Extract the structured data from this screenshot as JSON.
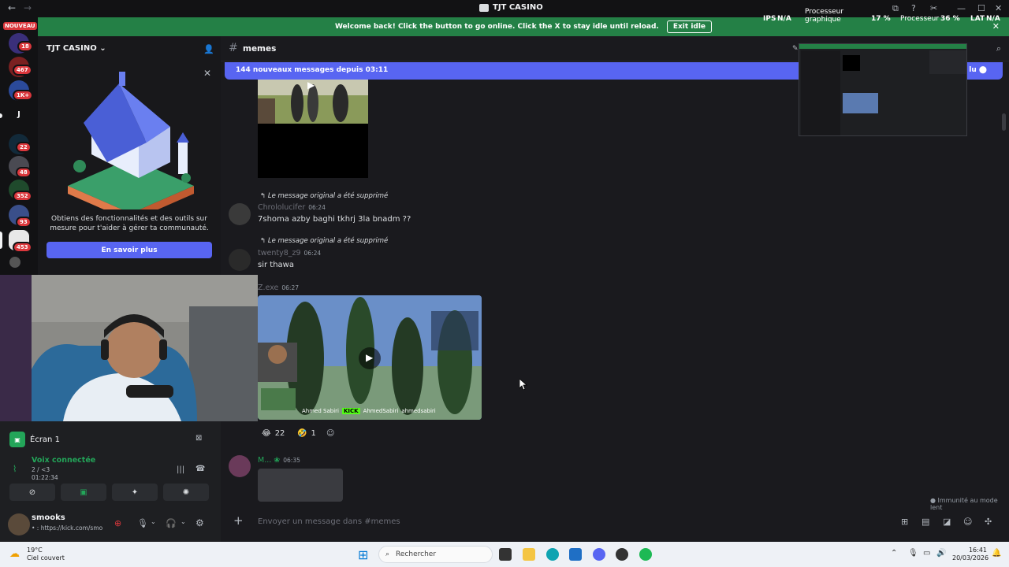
{
  "window": {
    "title": "TJT CASINO",
    "back": "←",
    "forward": "→",
    "minimize": "—",
    "maximize": "☐",
    "close": "✕"
  },
  "stats": {
    "ips_label": "IPS",
    "ips_value": "N/A",
    "gpu_label_1": "Processeur",
    "gpu_label_2": "graphique",
    "gpu_value": "17 %",
    "cpu_label": "Processeur",
    "cpu_value": "36 %",
    "lat_label": "LAT",
    "lat_value": "N/A"
  },
  "banner": {
    "text": "Welcome back! Click the button to go online. Click the X to stay idle until reload.",
    "button": "Exit idle",
    "close": "✕"
  },
  "rail": {
    "nouveau": "NOUVEAU",
    "badges": [
      "18",
      "18",
      "467",
      "1K+",
      "22",
      "48",
      "352",
      "93",
      "453"
    ],
    "letter_server": "J"
  },
  "sidebar": {
    "guild_name": "TJT CASINO",
    "promo_text": "Obtiens des fonctionnalités et des outils sur mesure pour t'aider à gérer ta communauté.",
    "promo_button": "En savoir plus",
    "close": "✕"
  },
  "voice": {
    "screen_label": "Écran 1",
    "status": "Voix connectée",
    "sub_1": "2 / <3",
    "sub_2": "01:22:34",
    "user_name": "smooks",
    "user_status": "• : https://kick.com/smo"
  },
  "chat": {
    "channel": "memes",
    "new_messages": "144 nouveaux messages depuis 03:11",
    "mark_read": "lu",
    "messages": [
      {
        "reply": "Le message original a été supprimé",
        "author": "Chrololucifer",
        "time": "06:24",
        "text": "7shoma azby baghi tkhrj 3la bnadm ??"
      },
      {
        "reply": "Le message original a été supprimé",
        "author": "twenty8_z9",
        "time": "06:24",
        "text": "sir   thawa"
      },
      {
        "author": "Z.exe",
        "time": "06:27",
        "overlay_1": "Ahmed Sabiri",
        "overlay_2": "KICK",
        "overlay_3": "AhmedSabiri",
        "overlay_4": "ahmedsabiri"
      },
      {
        "author": "M...",
        "time": "06:35"
      }
    ],
    "reactions": [
      {
        "emoji": "😂",
        "count": "22"
      },
      {
        "emoji": "🤣",
        "count": "1"
      }
    ],
    "composer_placeholder": "Envoyer un message dans #memes",
    "immunity": "Immunité au mode lent"
  },
  "taskbar": {
    "temp": "19°C",
    "weather": "Ciel couvert",
    "search": "Rechercher",
    "time": "16:41",
    "date": "20/03/2026"
  },
  "colors": {
    "accent": "#5865f2",
    "banner": "#248046",
    "voice_green": "#23a559",
    "badge_red": "#da373c"
  }
}
